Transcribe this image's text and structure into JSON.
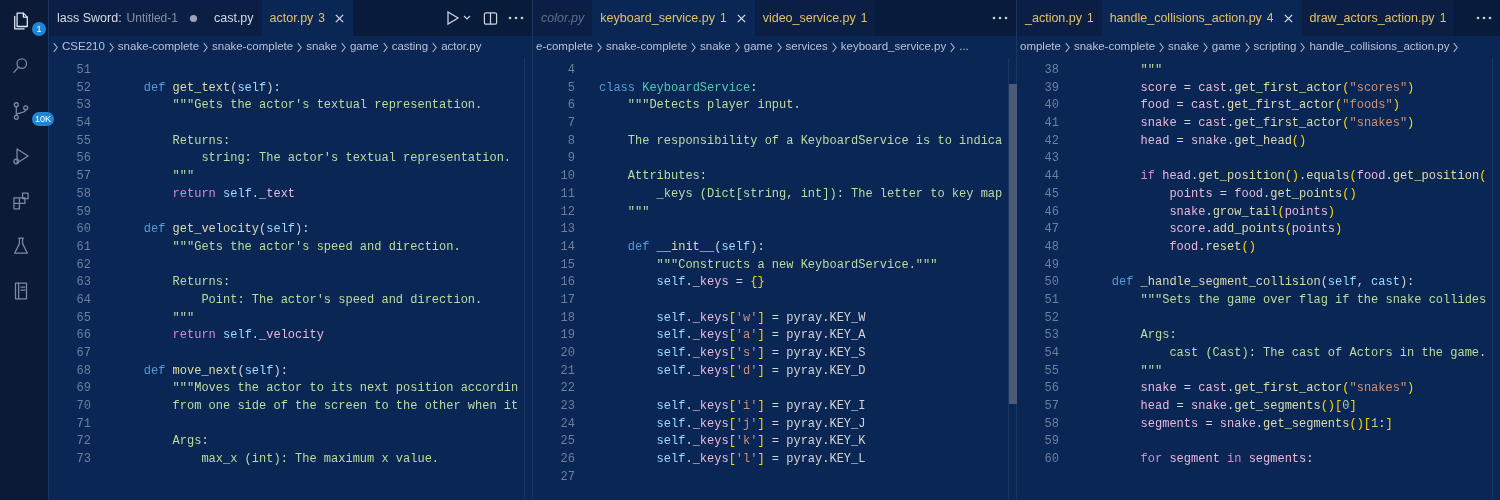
{
  "activity_bar": [
    {
      "kind": "explorer",
      "selected": true,
      "badge": "1"
    },
    {
      "kind": "search",
      "selected": false
    },
    {
      "kind": "source_control",
      "selected": false,
      "badge": "10K"
    },
    {
      "kind": "run_debug",
      "selected": false
    },
    {
      "kind": "extensions",
      "selected": false
    },
    {
      "kind": "testing",
      "selected": false
    },
    {
      "kind": "notebook",
      "selected": false
    }
  ],
  "editors": [
    {
      "tabs": [
        {
          "label": "lass Sword:",
          "description": "Untitled-1",
          "warning": false,
          "dimmed": false,
          "selected": false,
          "modified": true
        },
        {
          "label": "cast.py",
          "warning": false,
          "dimmed": false,
          "selected": false,
          "modified": false
        },
        {
          "label": "actor.py",
          "count": "3",
          "warning": true,
          "dimmed": false,
          "selected": true,
          "modified": false
        }
      ],
      "actions": [
        {
          "kind": "run"
        },
        {
          "kind": "split"
        },
        {
          "kind": "more"
        }
      ],
      "breadcrumbs": {
        "leading_chevron": true,
        "trailing_chevron": false,
        "items": [
          "CSE210",
          "snake-complete",
          "snake-complete",
          "snake",
          "game",
          "casting",
          "actor.py"
        ]
      },
      "scroll_thumb": false,
      "lines": [
        {
          "number": "51"
        },
        {
          "number": "52",
          "tokens": [
            {
              "kind": "kw",
              "text": "    def "
            },
            {
              "kind": "fn",
              "text": "get_text"
            },
            {
              "kind": "p",
              "text": "("
            },
            {
              "kind": "self",
              "text": "self"
            },
            {
              "kind": "p",
              "text": "):"
            }
          ]
        },
        {
          "number": "53",
          "tokens": [
            {
              "kind": "doc",
              "text": "        \"\"\"Gets the actor's textual representation."
            }
          ]
        },
        {
          "number": "54"
        },
        {
          "number": "55",
          "tokens": [
            {
              "kind": "doc",
              "text": "        Returns:"
            }
          ]
        },
        {
          "number": "56",
          "tokens": [
            {
              "kind": "doc",
              "text": "            string: The actor's textual representation."
            }
          ]
        },
        {
          "number": "57",
          "tokens": [
            {
              "kind": "doc",
              "text": "        \"\"\""
            }
          ]
        },
        {
          "number": "58",
          "tokens": [
            {
              "kind": "ctl",
              "text": "        return "
            },
            {
              "kind": "self",
              "text": "self"
            },
            {
              "kind": "p",
              "text": "."
            },
            {
              "kind": "var",
              "text": "_text"
            }
          ]
        },
        {
          "number": "59"
        },
        {
          "number": "60",
          "tokens": [
            {
              "kind": "kw",
              "text": "    def "
            },
            {
              "kind": "fn",
              "text": "get_velocity"
            },
            {
              "kind": "p",
              "text": "("
            },
            {
              "kind": "self",
              "text": "self"
            },
            {
              "kind": "p",
              "text": "):"
            }
          ]
        },
        {
          "number": "61",
          "tokens": [
            {
              "kind": "doc",
              "text": "        \"\"\"Gets the actor's speed and direction."
            }
          ]
        },
        {
          "number": "62"
        },
        {
          "number": "63",
          "tokens": [
            {
              "kind": "doc",
              "text": "        Returns:"
            }
          ]
        },
        {
          "number": "64",
          "tokens": [
            {
              "kind": "doc",
              "text": "            Point: The actor's speed and direction."
            }
          ]
        },
        {
          "number": "65",
          "tokens": [
            {
              "kind": "doc",
              "text": "        \"\"\""
            }
          ]
        },
        {
          "number": "66",
          "tokens": [
            {
              "kind": "ctl",
              "text": "        return "
            },
            {
              "kind": "self",
              "text": "self"
            },
            {
              "kind": "p",
              "text": "."
            },
            {
              "kind": "var",
              "text": "_velocity"
            }
          ]
        },
        {
          "number": "67"
        },
        {
          "number": "68",
          "tokens": [
            {
              "kind": "kw",
              "text": "    def "
            },
            {
              "kind": "fn",
              "text": "move_next"
            },
            {
              "kind": "p",
              "text": "("
            },
            {
              "kind": "self",
              "text": "self"
            },
            {
              "kind": "p",
              "text": "):"
            }
          ]
        },
        {
          "number": "69",
          "tokens": [
            {
              "kind": "doc",
              "text": "        \"\"\"Moves the actor to its next position accordin"
            }
          ]
        },
        {
          "number": "70",
          "tokens": [
            {
              "kind": "doc",
              "text": "        from one side of the screen to the other when it"
            }
          ]
        },
        {
          "number": "71"
        },
        {
          "number": "72",
          "tokens": [
            {
              "kind": "doc",
              "text": "        Args:"
            }
          ]
        },
        {
          "number": "73",
          "tokens": [
            {
              "kind": "doc",
              "text": "            max_x (int): The maximum x value."
            }
          ]
        }
      ]
    },
    {
      "tabs": [
        {
          "label": "color.py",
          "warning": false,
          "dimmed": true,
          "selected": false,
          "modified": false
        },
        {
          "label": "keyboard_service.py",
          "count": "1",
          "warning": true,
          "dimmed": false,
          "selected": true,
          "modified": false
        },
        {
          "label": "video_service.py",
          "count": "1",
          "warning": true,
          "dimmed": false,
          "selected": false,
          "modified": false
        }
      ],
      "actions": [
        {
          "kind": "more"
        }
      ],
      "breadcrumbs": {
        "leading_chevron": false,
        "trailing_chevron": false,
        "items": [
          "e-complete",
          "snake-complete",
          "snake",
          "game",
          "services",
          "keyboard_service.py",
          "..."
        ]
      },
      "scroll_thumb": true,
      "lines": [
        {
          "number": "4"
        },
        {
          "number": "5",
          "tokens": [
            {
              "kind": "kw",
              "text": "class "
            },
            {
              "kind": "cls",
              "text": "KeyboardService"
            },
            {
              "kind": "p",
              "text": ":"
            }
          ]
        },
        {
          "number": "6",
          "tokens": [
            {
              "kind": "doc",
              "text": "    \"\"\"Detects player input."
            }
          ]
        },
        {
          "number": "7"
        },
        {
          "number": "8",
          "tokens": [
            {
              "kind": "doc",
              "text": "    The responsibility of a KeyboardService is to indica"
            }
          ]
        },
        {
          "number": "9"
        },
        {
          "number": "10",
          "tokens": [
            {
              "kind": "doc",
              "text": "    Attributes:"
            }
          ]
        },
        {
          "number": "11",
          "tokens": [
            {
              "kind": "doc",
              "text": "        _keys (Dict[string, int]): The letter to key map"
            }
          ]
        },
        {
          "number": "12",
          "tokens": [
            {
              "kind": "doc",
              "text": "    \"\"\""
            }
          ]
        },
        {
          "number": "13"
        },
        {
          "number": "14",
          "tokens": [
            {
              "kind": "kw",
              "text": "    def "
            },
            {
              "kind": "fn",
              "text": "__init__"
            },
            {
              "kind": "p",
              "text": "("
            },
            {
              "kind": "self",
              "text": "self"
            },
            {
              "kind": "p",
              "text": "):"
            }
          ]
        },
        {
          "number": "15",
          "tokens": [
            {
              "kind": "doc",
              "text": "        \"\"\"Constructs a new KeyboardService.\"\"\""
            }
          ]
        },
        {
          "number": "16",
          "tokens": [
            {
              "kind": "self",
              "text": "        self"
            },
            {
              "kind": "p",
              "text": "."
            },
            {
              "kind": "var",
              "text": "_keys"
            },
            {
              "kind": "p",
              "text": " = "
            },
            {
              "kind": "brk",
              "text": "{}"
            }
          ]
        },
        {
          "number": "17"
        },
        {
          "number": "18",
          "tokens": [
            {
              "kind": "self",
              "text": "        self"
            },
            {
              "kind": "p",
              "text": "."
            },
            {
              "kind": "var",
              "text": "_keys"
            },
            {
              "kind": "brk",
              "text": "["
            },
            {
              "kind": "str",
              "text": "'w'"
            },
            {
              "kind": "brk",
              "text": "]"
            },
            {
              "kind": "p",
              "text": " = pyray.KEY_W"
            }
          ]
        },
        {
          "number": "19",
          "tokens": [
            {
              "kind": "self",
              "text": "        self"
            },
            {
              "kind": "p",
              "text": "."
            },
            {
              "kind": "var",
              "text": "_keys"
            },
            {
              "kind": "brk",
              "text": "["
            },
            {
              "kind": "str",
              "text": "'a'"
            },
            {
              "kind": "brk",
              "text": "]"
            },
            {
              "kind": "p",
              "text": " = pyray.KEY_A"
            }
          ]
        },
        {
          "number": "20",
          "tokens": [
            {
              "kind": "self",
              "text": "        self"
            },
            {
              "kind": "p",
              "text": "."
            },
            {
              "kind": "var",
              "text": "_keys"
            },
            {
              "kind": "brk",
              "text": "["
            },
            {
              "kind": "str",
              "text": "'s'"
            },
            {
              "kind": "brk",
              "text": "]"
            },
            {
              "kind": "p",
              "text": " = pyray.KEY_S"
            }
          ]
        },
        {
          "number": "21",
          "tokens": [
            {
              "kind": "self",
              "text": "        self"
            },
            {
              "kind": "p",
              "text": "."
            },
            {
              "kind": "var",
              "text": "_keys"
            },
            {
              "kind": "brk",
              "text": "["
            },
            {
              "kind": "str",
              "text": "'d'"
            },
            {
              "kind": "brk",
              "text": "]"
            },
            {
              "kind": "p",
              "text": " = pyray.KEY_D"
            }
          ]
        },
        {
          "number": "22"
        },
        {
          "number": "23",
          "tokens": [
            {
              "kind": "self",
              "text": "        self"
            },
            {
              "kind": "p",
              "text": "."
            },
            {
              "kind": "var",
              "text": "_keys"
            },
            {
              "kind": "brk",
              "text": "["
            },
            {
              "kind": "str",
              "text": "'i'"
            },
            {
              "kind": "brk",
              "text": "]"
            },
            {
              "kind": "p",
              "text": " = pyray.KEY_I"
            }
          ]
        },
        {
          "number": "24",
          "tokens": [
            {
              "kind": "self",
              "text": "        self"
            },
            {
              "kind": "p",
              "text": "."
            },
            {
              "kind": "var",
              "text": "_keys"
            },
            {
              "kind": "brk",
              "text": "["
            },
            {
              "kind": "str",
              "text": "'j'"
            },
            {
              "kind": "brk",
              "text": "]"
            },
            {
              "kind": "p",
              "text": " = pyray.KEY_J"
            }
          ]
        },
        {
          "number": "25",
          "tokens": [
            {
              "kind": "self",
              "text": "        self"
            },
            {
              "kind": "p",
              "text": "."
            },
            {
              "kind": "var",
              "text": "_keys"
            },
            {
              "kind": "brk",
              "text": "["
            },
            {
              "kind": "str",
              "text": "'k'"
            },
            {
              "kind": "brk",
              "text": "]"
            },
            {
              "kind": "p",
              "text": " = pyray.KEY_K"
            }
          ]
        },
        {
          "number": "26",
          "tokens": [
            {
              "kind": "self",
              "text": "        self"
            },
            {
              "kind": "p",
              "text": "."
            },
            {
              "kind": "var",
              "text": "_keys"
            },
            {
              "kind": "brk",
              "text": "["
            },
            {
              "kind": "str",
              "text": "'l'"
            },
            {
              "kind": "brk",
              "text": "]"
            },
            {
              "kind": "p",
              "text": " = pyray.KEY_L"
            }
          ]
        },
        {
          "number": "27"
        }
      ]
    },
    {
      "tabs": [
        {
          "label": "_action.py",
          "count": "1",
          "warning": true,
          "dimmed": false,
          "selected": false,
          "modified": false
        },
        {
          "label": "handle_collisions_action.py",
          "count": "4",
          "warning": true,
          "dimmed": false,
          "selected": true,
          "modified": false
        },
        {
          "label": "draw_actors_action.py",
          "count": "1",
          "warning": true,
          "dimmed": false,
          "selected": false,
          "modified": false
        }
      ],
      "actions": [
        {
          "kind": "more"
        }
      ],
      "breadcrumbs": {
        "leading_chevron": false,
        "trailing_chevron": true,
        "items": [
          "omplete",
          "snake-complete",
          "snake",
          "game",
          "scripting",
          "handle_collisions_action.py"
        ]
      },
      "scroll_thumb": false,
      "lines": [
        {
          "number": "38",
          "tokens": [
            {
              "kind": "doc",
              "text": "        \"\"\""
            }
          ]
        },
        {
          "number": "39",
          "tokens": [
            {
              "kind": "var",
              "text": "        score"
            },
            {
              "kind": "p",
              "text": " = "
            },
            {
              "kind": "var",
              "text": "cast"
            },
            {
              "kind": "p",
              "text": "."
            },
            {
              "kind": "fn",
              "text": "get_first_actor"
            },
            {
              "kind": "brk",
              "text": "("
            },
            {
              "kind": "str",
              "text": "\"scores\""
            },
            {
              "kind": "brk",
              "text": ")"
            }
          ]
        },
        {
          "number": "40",
          "tokens": [
            {
              "kind": "var",
              "text": "        food"
            },
            {
              "kind": "p",
              "text": " = "
            },
            {
              "kind": "var",
              "text": "cast"
            },
            {
              "kind": "p",
              "text": "."
            },
            {
              "kind": "fn",
              "text": "get_first_actor"
            },
            {
              "kind": "brk",
              "text": "("
            },
            {
              "kind": "str",
              "text": "\"foods\""
            },
            {
              "kind": "brk",
              "text": ")"
            }
          ]
        },
        {
          "number": "41",
          "tokens": [
            {
              "kind": "var",
              "text": "        snake"
            },
            {
              "kind": "p",
              "text": " = "
            },
            {
              "kind": "var",
              "text": "cast"
            },
            {
              "kind": "p",
              "text": "."
            },
            {
              "kind": "fn",
              "text": "get_first_actor"
            },
            {
              "kind": "brk",
              "text": "("
            },
            {
              "kind": "str",
              "text": "\"snakes\""
            },
            {
              "kind": "brk",
              "text": ")"
            }
          ]
        },
        {
          "number": "42",
          "tokens": [
            {
              "kind": "var",
              "text": "        head"
            },
            {
              "kind": "p",
              "text": " = "
            },
            {
              "kind": "var",
              "text": "snake"
            },
            {
              "kind": "p",
              "text": "."
            },
            {
              "kind": "fn",
              "text": "get_head"
            },
            {
              "kind": "brk",
              "text": "()"
            }
          ]
        },
        {
          "number": "43"
        },
        {
          "number": "44",
          "tokens": [
            {
              "kind": "ctl",
              "text": "        if "
            },
            {
              "kind": "var",
              "text": "head"
            },
            {
              "kind": "p",
              "text": "."
            },
            {
              "kind": "fn",
              "text": "get_position"
            },
            {
              "kind": "brk",
              "text": "()"
            },
            {
              "kind": "p",
              "text": "."
            },
            {
              "kind": "fn",
              "text": "equals"
            },
            {
              "kind": "brk",
              "text": "("
            },
            {
              "kind": "var",
              "text": "food"
            },
            {
              "kind": "p",
              "text": "."
            },
            {
              "kind": "fn",
              "text": "get_position"
            },
            {
              "kind": "brk",
              "text": "("
            }
          ]
        },
        {
          "number": "45",
          "tokens": [
            {
              "kind": "var",
              "text": "            points"
            },
            {
              "kind": "p",
              "text": " = "
            },
            {
              "kind": "var",
              "text": "food"
            },
            {
              "kind": "p",
              "text": "."
            },
            {
              "kind": "fn",
              "text": "get_points"
            },
            {
              "kind": "brk",
              "text": "()"
            }
          ]
        },
        {
          "number": "46",
          "tokens": [
            {
              "kind": "var",
              "text": "            snake"
            },
            {
              "kind": "p",
              "text": "."
            },
            {
              "kind": "fn",
              "text": "grow_tail"
            },
            {
              "kind": "brk",
              "text": "("
            },
            {
              "kind": "var",
              "text": "points"
            },
            {
              "kind": "brk",
              "text": ")"
            }
          ]
        },
        {
          "number": "47",
          "tokens": [
            {
              "kind": "var",
              "text": "            score"
            },
            {
              "kind": "p",
              "text": "."
            },
            {
              "kind": "fn",
              "text": "add_points"
            },
            {
              "kind": "brk",
              "text": "("
            },
            {
              "kind": "var",
              "text": "points"
            },
            {
              "kind": "brk",
              "text": ")"
            }
          ]
        },
        {
          "number": "48",
          "tokens": [
            {
              "kind": "var",
              "text": "            food"
            },
            {
              "kind": "p",
              "text": "."
            },
            {
              "kind": "fn",
              "text": "reset"
            },
            {
              "kind": "brk",
              "text": "()"
            }
          ]
        },
        {
          "number": "49"
        },
        {
          "number": "50",
          "tokens": [
            {
              "kind": "kw",
              "text": "    def "
            },
            {
              "kind": "fn",
              "text": "_handle_segment_collision"
            },
            {
              "kind": "p",
              "text": "("
            },
            {
              "kind": "self",
              "text": "self"
            },
            {
              "kind": "p",
              "text": ", "
            },
            {
              "kind": "self",
              "text": "cast"
            },
            {
              "kind": "p",
              "text": "):"
            }
          ]
        },
        {
          "number": "51",
          "tokens": [
            {
              "kind": "doc",
              "text": "        \"\"\"Sets the game over flag if the snake collides"
            }
          ]
        },
        {
          "number": "52"
        },
        {
          "number": "53",
          "tokens": [
            {
              "kind": "doc",
              "text": "        Args:"
            }
          ]
        },
        {
          "number": "54",
          "tokens": [
            {
              "kind": "doc",
              "text": "            cast (Cast): The cast of Actors in the game."
            }
          ]
        },
        {
          "number": "55",
          "tokens": [
            {
              "kind": "doc",
              "text": "        \"\"\""
            }
          ]
        },
        {
          "number": "56",
          "tokens": [
            {
              "kind": "var",
              "text": "        snake"
            },
            {
              "kind": "p",
              "text": " = "
            },
            {
              "kind": "var",
              "text": "cast"
            },
            {
              "kind": "p",
              "text": "."
            },
            {
              "kind": "fn",
              "text": "get_first_actor"
            },
            {
              "kind": "brk",
              "text": "("
            },
            {
              "kind": "str",
              "text": "\"snakes\""
            },
            {
              "kind": "brk",
              "text": ")"
            }
          ]
        },
        {
          "number": "57",
          "tokens": [
            {
              "kind": "var",
              "text": "        head"
            },
            {
              "kind": "p",
              "text": " = "
            },
            {
              "kind": "var",
              "text": "snake"
            },
            {
              "kind": "p",
              "text": "."
            },
            {
              "kind": "fn",
              "text": "get_segments"
            },
            {
              "kind": "brk",
              "text": "()["
            },
            {
              "kind": "num",
              "text": "0"
            },
            {
              "kind": "brk",
              "text": "]"
            }
          ]
        },
        {
          "number": "58",
          "tokens": [
            {
              "kind": "var",
              "text": "        segments"
            },
            {
              "kind": "p",
              "text": " = "
            },
            {
              "kind": "var",
              "text": "snake"
            },
            {
              "kind": "p",
              "text": "."
            },
            {
              "kind": "fn",
              "text": "get_segments"
            },
            {
              "kind": "brk",
              "text": "()["
            },
            {
              "kind": "num",
              "text": "1"
            },
            {
              "kind": "p",
              "text": ":"
            },
            {
              "kind": "brk",
              "text": "]"
            }
          ]
        },
        {
          "number": "59"
        },
        {
          "number": "60",
          "tokens": [
            {
              "kind": "ctl",
              "text": "        for "
            },
            {
              "kind": "var",
              "text": "segment"
            },
            {
              "kind": "ctl",
              "text": " in "
            },
            {
              "kind": "var",
              "text": "segments"
            },
            {
              "kind": "p",
              "text": ":"
            }
          ]
        }
      ]
    }
  ]
}
